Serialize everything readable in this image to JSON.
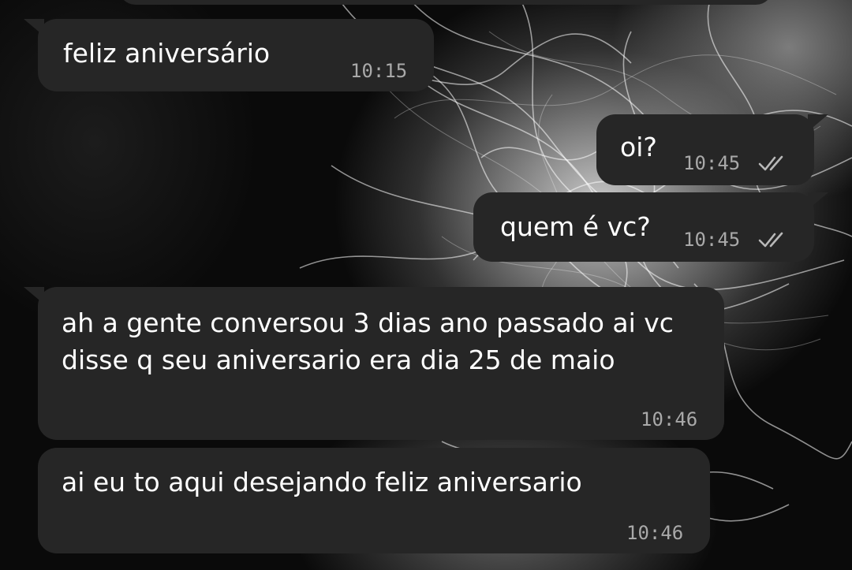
{
  "conversation": {
    "messages": [
      {
        "direction": "incoming",
        "text": "feliz aniversário",
        "time": "10:15"
      },
      {
        "direction": "outgoing",
        "text": "oi?",
        "time": "10:45",
        "status_icon": "double-check-icon"
      },
      {
        "direction": "outgoing",
        "text": "quem é vc?",
        "time": "10:45",
        "status_icon": "double-check-icon"
      },
      {
        "direction": "incoming",
        "text": "ah a gente conversou 3 dias ano passado ai vc disse q seu aniversario era dia 25 de maio",
        "time": "10:46"
      },
      {
        "direction": "incoming",
        "text": "ai eu to aqui desejando feliz aniversario",
        "time": "10:46"
      }
    ]
  },
  "colors": {
    "bubble": "#262626",
    "text": "#ffffff",
    "timestamp": "#a9a9a9",
    "ticks": "#b8b8b8"
  }
}
